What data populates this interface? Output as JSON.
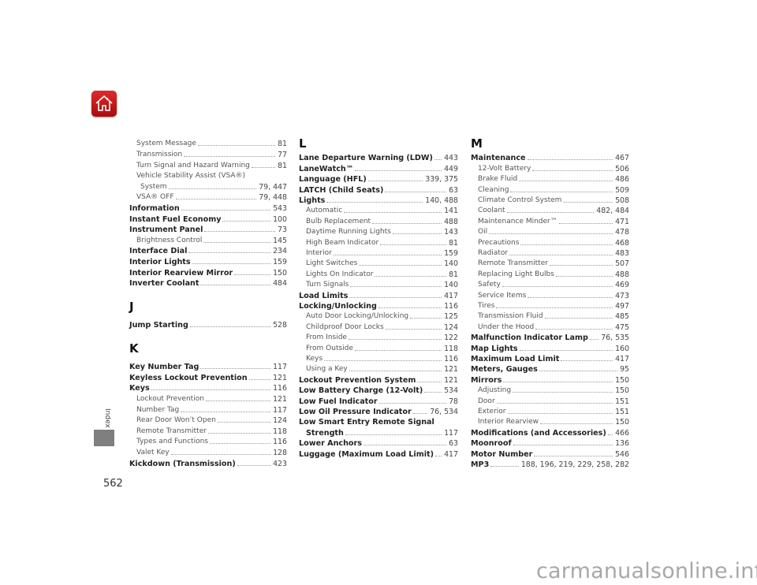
{
  "page_number": "562",
  "side_tab": "Index",
  "watermark": "carmanualsonline.info",
  "brand_color": "#c41616",
  "home_icon": "home-icon",
  "columns": [
    {
      "items": [
        {
          "type": "entry",
          "text": "System Message",
          "page": "81",
          "level": 1,
          "bold": false
        },
        {
          "type": "entry",
          "text": "Transmission",
          "page": "77",
          "level": 1,
          "bold": false
        },
        {
          "type": "entry",
          "text": "Turn Signal and Hazard Warning",
          "page": "81",
          "level": 1,
          "bold": false
        },
        {
          "type": "entry",
          "text": "Vehicle Stability Assist (VSA®)",
          "page": "",
          "level": 1,
          "bold": false
        },
        {
          "type": "entry",
          "text": "System",
          "page": "79, 447",
          "level": 2,
          "bold": false
        },
        {
          "type": "entry",
          "text": "VSA® OFF",
          "page": "79, 448",
          "level": 1,
          "bold": false
        },
        {
          "type": "entry",
          "text": "Information",
          "page": "543",
          "level": 0,
          "bold": true
        },
        {
          "type": "entry",
          "text": "Instant Fuel Economy",
          "page": "100",
          "level": 0,
          "bold": true
        },
        {
          "type": "entry",
          "text": "Instrument Panel",
          "page": "73",
          "level": 0,
          "bold": true
        },
        {
          "type": "entry",
          "text": "Brightness Control",
          "page": "145",
          "level": 1,
          "bold": false
        },
        {
          "type": "entry",
          "text": "Interface Dial",
          "page": "234",
          "level": 0,
          "bold": true
        },
        {
          "type": "entry",
          "text": "Interior Lights",
          "page": "159",
          "level": 0,
          "bold": true
        },
        {
          "type": "entry",
          "text": "Interior Rearview Mirror",
          "page": "150",
          "level": 0,
          "bold": true
        },
        {
          "type": "entry",
          "text": "Inverter Coolant",
          "page": "484",
          "level": 0,
          "bold": true
        },
        {
          "type": "heading",
          "text": "J"
        },
        {
          "type": "entry",
          "text": "Jump Starting",
          "page": "528",
          "level": 0,
          "bold": true
        },
        {
          "type": "heading",
          "text": "K"
        },
        {
          "type": "entry",
          "text": "Key Number Tag",
          "page": "117",
          "level": 0,
          "bold": true
        },
        {
          "type": "entry",
          "text": "Keyless Lockout Prevention",
          "page": "121",
          "level": 0,
          "bold": true
        },
        {
          "type": "entry",
          "text": "Keys",
          "page": "116",
          "level": 0,
          "bold": true
        },
        {
          "type": "entry",
          "text": "Lockout Prevention",
          "page": "121",
          "level": 1,
          "bold": false
        },
        {
          "type": "entry",
          "text": "Number Tag",
          "page": "117",
          "level": 1,
          "bold": false
        },
        {
          "type": "entry",
          "text": "Rear Door Won’t Open",
          "page": "124",
          "level": 1,
          "bold": false
        },
        {
          "type": "entry",
          "text": "Remote Transmitter",
          "page": "118",
          "level": 1,
          "bold": false
        },
        {
          "type": "entry",
          "text": "Types and Functions",
          "page": "116",
          "level": 1,
          "bold": false
        },
        {
          "type": "entry",
          "text": "Valet Key",
          "page": "128",
          "level": 1,
          "bold": false
        },
        {
          "type": "entry",
          "text": "Kickdown (Transmission)",
          "page": "423",
          "level": 0,
          "bold": true
        }
      ]
    },
    {
      "items": [
        {
          "type": "heading",
          "text": "L"
        },
        {
          "type": "entry",
          "text": "Lane Departure Warning (LDW)",
          "page": "443",
          "level": 0,
          "bold": true
        },
        {
          "type": "entry",
          "text": "LaneWatch™",
          "page": "449",
          "level": 0,
          "bold": true
        },
        {
          "type": "entry",
          "text": "Language (HFL)",
          "page": "339, 375",
          "level": 0,
          "bold": true
        },
        {
          "type": "entry",
          "text": "LATCH (Child Seats)",
          "page": "63",
          "level": 0,
          "bold": true
        },
        {
          "type": "entry",
          "text": "Lights",
          "page": "140, 488",
          "level": 0,
          "bold": true
        },
        {
          "type": "entry",
          "text": "Automatic",
          "page": "141",
          "level": 1,
          "bold": false
        },
        {
          "type": "entry",
          "text": "Bulb Replacement",
          "page": "488",
          "level": 1,
          "bold": false
        },
        {
          "type": "entry",
          "text": "Daytime Running Lights",
          "page": "143",
          "level": 1,
          "bold": false
        },
        {
          "type": "entry",
          "text": "High Beam Indicator",
          "page": "81",
          "level": 1,
          "bold": false
        },
        {
          "type": "entry",
          "text": "Interior",
          "page": "159",
          "level": 1,
          "bold": false
        },
        {
          "type": "entry",
          "text": "Light Switches",
          "page": "140",
          "level": 1,
          "bold": false
        },
        {
          "type": "entry",
          "text": "Lights On Indicator",
          "page": "81",
          "level": 1,
          "bold": false
        },
        {
          "type": "entry",
          "text": "Turn Signals",
          "page": "140",
          "level": 1,
          "bold": false
        },
        {
          "type": "entry",
          "text": "Load Limits",
          "page": "417",
          "level": 0,
          "bold": true
        },
        {
          "type": "entry",
          "text": "Locking/Unlocking",
          "page": "116",
          "level": 0,
          "bold": true
        },
        {
          "type": "entry",
          "text": "Auto Door Locking/Unlocking",
          "page": "125",
          "level": 1,
          "bold": false
        },
        {
          "type": "entry",
          "text": "Childproof Door Locks",
          "page": "124",
          "level": 1,
          "bold": false
        },
        {
          "type": "entry",
          "text": "From Inside",
          "page": "122",
          "level": 1,
          "bold": false
        },
        {
          "type": "entry",
          "text": "From Outside",
          "page": "118",
          "level": 1,
          "bold": false
        },
        {
          "type": "entry",
          "text": "Keys",
          "page": "116",
          "level": 1,
          "bold": false
        },
        {
          "type": "entry",
          "text": "Using a Key",
          "page": "121",
          "level": 1,
          "bold": false
        },
        {
          "type": "entry",
          "text": "Lockout Prevention System",
          "page": "121",
          "level": 0,
          "bold": true
        },
        {
          "type": "entry",
          "text": "Low Battery Charge (12-Volt)",
          "page": "534",
          "level": 0,
          "bold": true
        },
        {
          "type": "entry",
          "text": "Low Fuel Indicator",
          "page": "78",
          "level": 0,
          "bold": true
        },
        {
          "type": "entry",
          "text": "Low Oil Pressure Indicator",
          "page": "76, 534",
          "level": 0,
          "bold": true
        },
        {
          "type": "entry",
          "text": "Low Smart Entry Remote Signal",
          "page": "",
          "level": 0,
          "bold": true
        },
        {
          "type": "entry",
          "text": "Strength",
          "page": "117",
          "level": 1,
          "bold": true
        },
        {
          "type": "entry",
          "text": "Lower Anchors",
          "page": "63",
          "level": 0,
          "bold": true
        },
        {
          "type": "entry",
          "text": "Luggage (Maximum Load Limit)",
          "page": "417",
          "level": 0,
          "bold": true
        }
      ]
    },
    {
      "items": [
        {
          "type": "heading",
          "text": "M"
        },
        {
          "type": "entry",
          "text": "Maintenance",
          "page": "467",
          "level": 0,
          "bold": true
        },
        {
          "type": "entry",
          "text": "12-Volt Battery",
          "page": "506",
          "level": 1,
          "bold": false
        },
        {
          "type": "entry",
          "text": "Brake Fluid",
          "page": "486",
          "level": 1,
          "bold": false
        },
        {
          "type": "entry",
          "text": "Cleaning",
          "page": "509",
          "level": 1,
          "bold": false
        },
        {
          "type": "entry",
          "text": "Climate Control System",
          "page": "508",
          "level": 1,
          "bold": false
        },
        {
          "type": "entry",
          "text": "Coolant",
          "page": "482, 484",
          "level": 1,
          "bold": false
        },
        {
          "type": "entry",
          "text": "Maintenance Minder™",
          "page": "471",
          "level": 1,
          "bold": false
        },
        {
          "type": "entry",
          "text": "Oil",
          "page": "478",
          "level": 1,
          "bold": false
        },
        {
          "type": "entry",
          "text": "Precautions",
          "page": "468",
          "level": 1,
          "bold": false
        },
        {
          "type": "entry",
          "text": "Radiator",
          "page": "483",
          "level": 1,
          "bold": false
        },
        {
          "type": "entry",
          "text": "Remote Transmitter",
          "page": "507",
          "level": 1,
          "bold": false
        },
        {
          "type": "entry",
          "text": "Replacing Light Bulbs",
          "page": "488",
          "level": 1,
          "bold": false
        },
        {
          "type": "entry",
          "text": "Safety",
          "page": "469",
          "level": 1,
          "bold": false
        },
        {
          "type": "entry",
          "text": "Service Items",
          "page": "473",
          "level": 1,
          "bold": false
        },
        {
          "type": "entry",
          "text": "Tires",
          "page": "497",
          "level": 1,
          "bold": false
        },
        {
          "type": "entry",
          "text": "Transmission Fluid",
          "page": "485",
          "level": 1,
          "bold": false
        },
        {
          "type": "entry",
          "text": "Under the Hood",
          "page": "475",
          "level": 1,
          "bold": false
        },
        {
          "type": "entry",
          "text": "Malfunction Indicator Lamp",
          "page": "76, 535",
          "level": 0,
          "bold": true
        },
        {
          "type": "entry",
          "text": "Map Lights",
          "page": "160",
          "level": 0,
          "bold": true
        },
        {
          "type": "entry",
          "text": "Maximum Load Limit",
          "page": "417",
          "level": 0,
          "bold": true
        },
        {
          "type": "entry",
          "text": "Meters, Gauges",
          "page": "95",
          "level": 0,
          "bold": true
        },
        {
          "type": "entry",
          "text": "Mirrors",
          "page": "150",
          "level": 0,
          "bold": true
        },
        {
          "type": "entry",
          "text": "Adjusting",
          "page": "150",
          "level": 1,
          "bold": false
        },
        {
          "type": "entry",
          "text": "Door",
          "page": "151",
          "level": 1,
          "bold": false
        },
        {
          "type": "entry",
          "text": "Exterior",
          "page": "151",
          "level": 1,
          "bold": false
        },
        {
          "type": "entry",
          "text": "Interior Rearview",
          "page": "150",
          "level": 1,
          "bold": false
        },
        {
          "type": "entry",
          "text": "Modifications (and Accessories)",
          "page": "466",
          "level": 0,
          "bold": true
        },
        {
          "type": "entry",
          "text": "Moonroof",
          "page": "136",
          "level": 0,
          "bold": true
        },
        {
          "type": "entry",
          "text": "Motor Number",
          "page": "546",
          "level": 0,
          "bold": true
        },
        {
          "type": "entry",
          "text": "MP3",
          "page": "188, 196, 219, 229, 258, 282",
          "level": 0,
          "bold": true
        }
      ]
    }
  ]
}
